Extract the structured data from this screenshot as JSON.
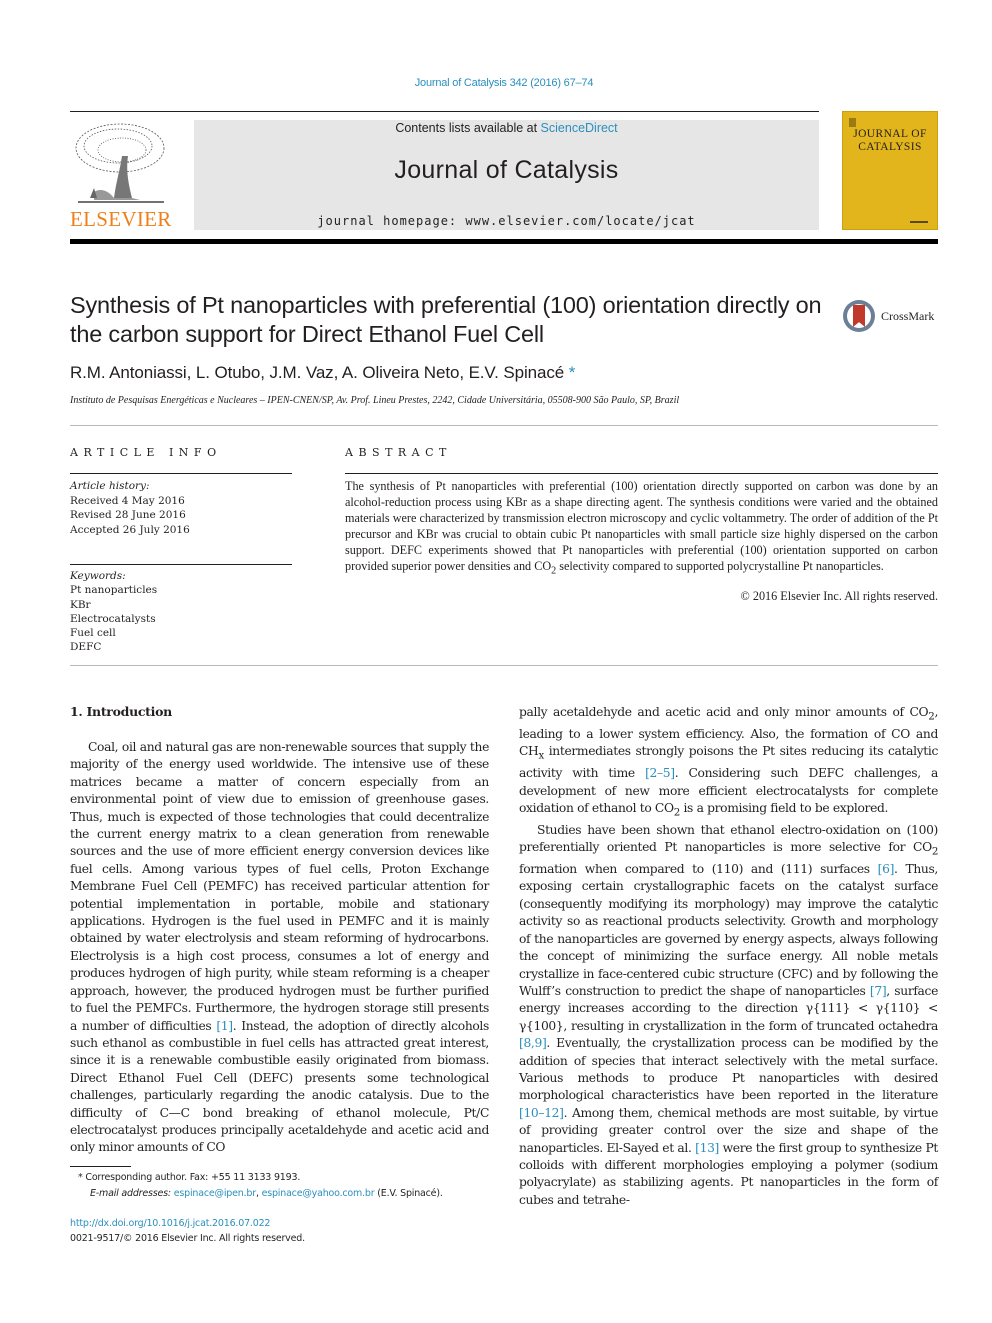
{
  "header": {
    "citation": "Journal of Catalysis 342 (2016) 67–74",
    "contents_prefix": "Contents lists available at ",
    "contents_link": "ScienceDirect",
    "journal_name": "Journal of Catalysis",
    "homepage": "journal homepage: www.elsevier.com/locate/jcat",
    "publisher_logo_text": "ELSEVIER",
    "cover_title_line1": "JOURNAL OF",
    "cover_title_line2": "CATALYSIS",
    "logo_icon": "elsevier-tree-icon",
    "crossmark_label": "CrossMark"
  },
  "article": {
    "title": "Synthesis of Pt nanoparticles with preferential (100) orientation directly on the carbon support for Direct Ethanol Fuel Cell",
    "authors": "R.M. Antoniassi, L. Otubo, J.M. Vaz, A. Oliveira Neto, E.V. Spinacé",
    "corresponding_mark": "*",
    "affiliation": "Instituto de Pesquisas Energéticas e Nucleares – IPEN-CNEN/SP, Av. Prof. Lineu Prestes, 2242, Cidade Universitária, 05508-900 São Paulo, SP, Brazil"
  },
  "article_info": {
    "heading": "ARTICLE INFO",
    "history_label": "Article history:",
    "history": [
      "Received 4 May 2016",
      "Revised 28 June 2016",
      "Accepted 26 July 2016"
    ],
    "keywords_label": "Keywords:",
    "keywords": [
      "Pt nanoparticles",
      "KBr",
      "Electrocatalysts",
      "Fuel cell",
      "DEFC"
    ]
  },
  "abstract": {
    "heading": "ABSTRACT",
    "text_part1": "The synthesis of Pt nanoparticles with preferential (100) orientation directly supported on carbon was done by an alcohol-reduction process using KBr as a shape directing agent. The synthesis conditions were varied and the obtained materials were characterized by transmission electron microscopy and cyclic voltammetry. The order of addition of the Pt precursor and KBr was crucial to obtain cubic Pt nanoparticles with small particle size highly dispersed on the carbon support. DEFC experiments showed that Pt nanoparticles with preferential (100) orientation supported on carbon provided superior power densities and CO",
    "text_sub": "2",
    "text_part2": " selectivity compared to supported polycrystalline Pt nanoparticles.",
    "copyright": "© 2016 Elsevier Inc. All rights reserved."
  },
  "body": {
    "section_title": "1. Introduction",
    "left_p1_a": "Coal, oil and natural gas are non-renewable sources that supply the majority of the energy used worldwide. The intensive use of these matrices became a matter of concern especially from an environmental point of view due to emission of greenhouse gases. Thus, much is expected of those technologies that could decentralize the current energy matrix to a clean generation from renewable sources and the use of more efficient energy conversion devices like fuel cells. Among various types of fuel cells, Proton Exchange Membrane Fuel Cell (PEMFC) has received particular attention for potential implementation in portable, mobile and stationary applications. Hydrogen is the fuel used in PEMFC and it is mainly obtained by water electrolysis and steam reforming of hydrocarbons. Electrolysis is a high cost process, consumes a lot of energy and produces hydrogen of high purity, while steam reforming is a cheaper approach, however, the produced hydrogen must be further purified to fuel the PEMFCs. Furthermore, the hydrogen storage still presents a number of difficulties ",
    "ref_1": "[1]",
    "left_p1_b": ". Instead, the adoption of directly alcohols such ethanol as combustible in fuel cells has attracted great interest, since it is a renewable combustible easily originated from biomass. Direct Ethanol Fuel Cell (DEFC) presents some technological challenges, particularly regarding the anodic catalysis. Due to the difficulty of C—C bond breaking of ethanol molecule, Pt/C electrocatalyst produces principally acetaldehyde and acetic acid and only minor amounts of CO",
    "right_p1_a": "pally acetaldehyde and acetic acid and only minor amounts of CO",
    "right_p1_b": ", leading to a lower system efficiency. Also, the formation of CO and CH",
    "right_p1_c": " intermediates strongly poisons the Pt sites reducing its catalytic activity with time ",
    "ref_2_5": "[2–5]",
    "right_p1_d": ". Considering such DEFC challenges, a development of new more efficient electrocatalysts for complete oxidation of ethanol to CO",
    "right_p1_e": " is a promising field to be explored.",
    "right_p2_a": "Studies have been shown that ethanol electro-oxidation on (100) preferentially oriented Pt nanoparticles is more selective for CO",
    "right_p2_b": " formation when compared to (110) and (111) surfaces ",
    "ref_6": "[6]",
    "right_p2_c": ". Thus, exposing certain crystallographic facets on the catalyst surface (consequently modifying its morphology) may improve the catalytic activity so as reactional products selectivity. Growth and morphology of the nanoparticles are governed by energy aspects, always following the concept of minimizing the surface energy. All noble metals crystallize in face-centered cubic structure (CFC) and by following the Wulff’s construction to predict the shape of nanoparticles ",
    "ref_7": "[7]",
    "right_p2_d": ", surface energy increases according to the direction γ{111} < γ{110} < γ{100}, resulting in crystallization in the form of truncated octahedra ",
    "ref_8_9": "[8,9]",
    "right_p2_e": ". Eventually, the crystallization process can be modified by the addition of species that interact selectively with the metal surface. Various methods to produce Pt nanoparticles with desired morphological characteristics have been reported in the literature ",
    "ref_10_12": "[10–12]",
    "right_p2_f": ". Among them, chemical methods are most suitable, by virtue of providing greater control over the size and shape of the nanoparticles. El-Sayed et al. ",
    "ref_13": "[13]",
    "right_p2_g": " were the first group to synthesize Pt colloids with different morphologies employing a polymer (sodium polyacrylate) as stabilizing agents. Pt nanoparticles in the form of cubes and tetrahe-",
    "sub_2": "2",
    "sub_x": "x"
  },
  "footnote": {
    "star": "*",
    "corresponding": " Corresponding author. Fax: +55 11 3133 9193.",
    "email_label": "E-mail addresses: ",
    "email1": "espinace@ipen.br",
    "sep": ", ",
    "email2": "espinace@yahoo.com.br",
    "email_owner": " (E.V. Spinacé).",
    "doi": "http://dx.doi.org/10.1016/j.jcat.2016.07.022",
    "issn": "0021-9517/© 2016 Elsevier Inc. All rights reserved."
  }
}
